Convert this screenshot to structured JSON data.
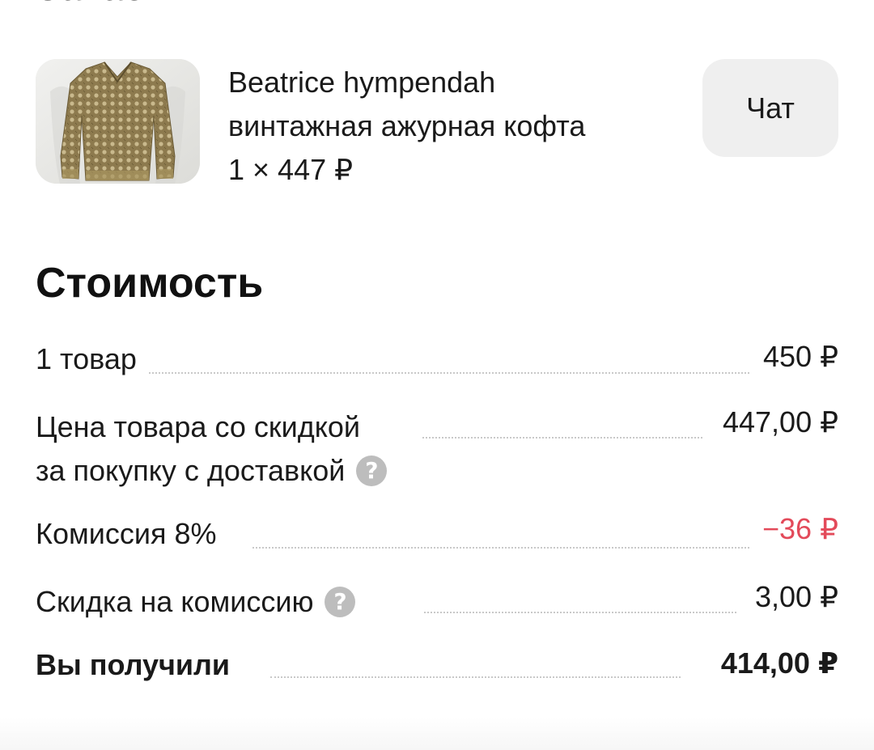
{
  "header": {
    "title_partial": "Заказ"
  },
  "product": {
    "image_alt": "openwork-blouse-photo",
    "name_line1": "Beatrice hympendah",
    "name_line2": "винтажная ажурная кофта",
    "qty_price": "1 × 447 ₽",
    "chat_button": "Чат"
  },
  "cost": {
    "title": "Стоимость",
    "items_label": "1 товар",
    "items_value": "450 ₽",
    "discount_price_line1": "Цена товара со скидкой",
    "discount_price_line2": "за покупку с доставкой",
    "discount_price_value": "447,00 ₽",
    "commission_label": "Комиссия 8%",
    "commission_value": "−36 ₽",
    "commission_discount_label": "Скидка на комиссию",
    "commission_discount_value": "3,00 ₽",
    "received_label": "Вы получили",
    "received_value": "414,00 ₽",
    "help_glyph": "?"
  },
  "colors": {
    "negative": "#e34a5a",
    "help_icon_bg": "#bdbdbd",
    "chat_button_bg": "#efefef"
  }
}
